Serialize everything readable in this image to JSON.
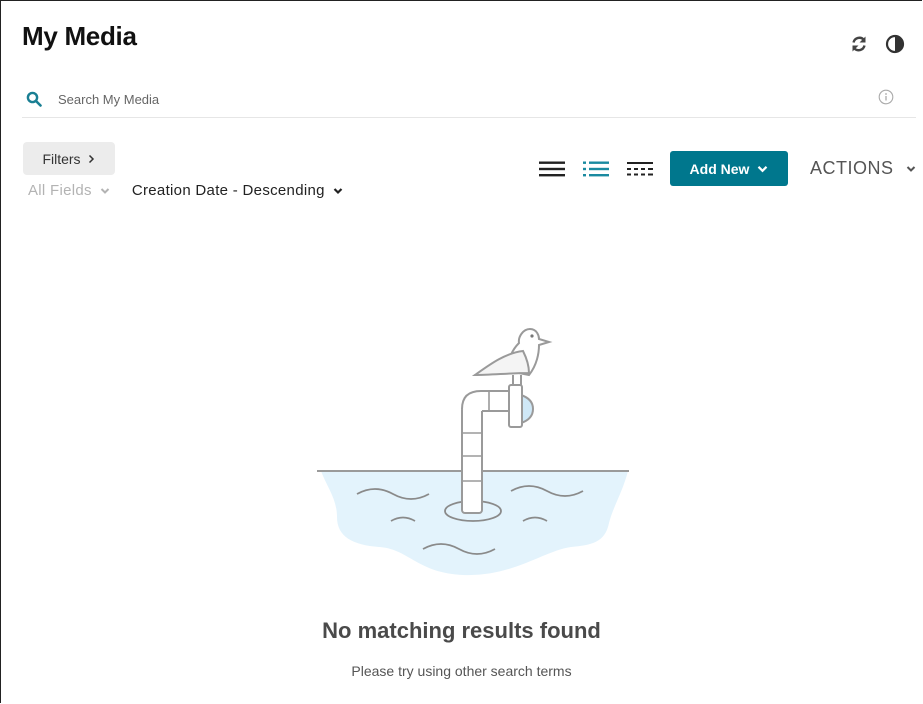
{
  "header": {
    "title": "My Media",
    "refresh_icon": "refresh-icon",
    "contrast_icon": "contrast-icon"
  },
  "search": {
    "placeholder": "Search My Media",
    "value": "",
    "icon": "search-icon",
    "info_icon": "info-icon"
  },
  "toolbar": {
    "filters_label": "Filters",
    "field_filter": "All Fields",
    "sort_label": "Creation Date - Descending",
    "view_modes": [
      "details-view",
      "list-view",
      "grid-view"
    ],
    "add_new_label": "Add New",
    "actions_label": "ACTIONS"
  },
  "empty_state": {
    "title": "No matching results found",
    "subtitle": "Please try using other search terms",
    "illustration": "seagull-periscope-illustration"
  },
  "colors": {
    "accent": "#00778d",
    "search_icon": "#1a7f93",
    "water": "#e3f3fc",
    "outline": "#9a9a9a"
  }
}
